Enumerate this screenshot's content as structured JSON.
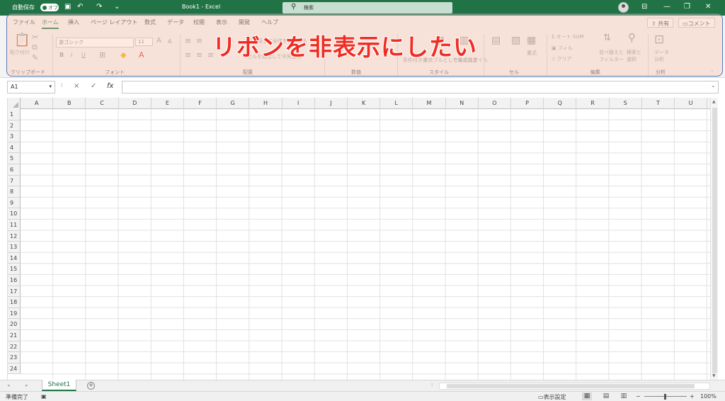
{
  "titlebar": {
    "autosave_label": "自動保存",
    "autosave_state": "オフ",
    "doc_title": "Book1  -  Excel",
    "search_placeholder": "検索",
    "icons": [
      "save-icon",
      "undo-icon",
      "redo-icon",
      "customize-icon",
      "account-icon",
      "ribbon-display-icon",
      "minimize-icon",
      "restore-icon",
      "close-icon"
    ]
  },
  "ribbon": {
    "tabs": [
      "ファイル",
      "ホーム",
      "挿入",
      "ページ レイアウト",
      "数式",
      "データ",
      "校閲",
      "表示",
      "開発",
      "ヘルプ"
    ],
    "active_tab": "ホーム",
    "share_label": "共有",
    "comment_label": "コメント",
    "clipboard": {
      "paste_label": "貼り付け",
      "group_label": "クリップボード"
    },
    "font": {
      "font_name": "游ゴシック",
      "font_size": "11",
      "grow": "A",
      "shrink": "A",
      "bold": "B",
      "italic": "I",
      "underline": "U",
      "group_label": "フォント"
    },
    "alignment": {
      "wrap_label": "折り返して全体を表示する",
      "merge_label": "セルを結合して中央揃え",
      "group_label": "配置"
    },
    "number": {
      "percent": "%",
      "group_label": "数値"
    },
    "styles": {
      "cond_format": "条件付き書式",
      "table_format": "テーブルとして書式設定",
      "cell_styles": "セルのスタイル",
      "group_label": "スタイル"
    },
    "cells": {
      "format_label": "書式",
      "group_label": "セル"
    },
    "editing": {
      "autosum": "オート SUM",
      "fill": "フィル",
      "clear": "クリア",
      "sort_filter": "並べ替えと フィルター",
      "find_select": "検索と 選択",
      "group_label": "編集"
    },
    "analysis": {
      "analyze_label": "データ 分析",
      "group_label": "分析"
    }
  },
  "overlay": {
    "headline": "リボンを非表示にしたい",
    "accent_color": "#ef2d22"
  },
  "formula_bar": {
    "name_box": "A1",
    "fx_label": "fx",
    "cancel_icon": "×",
    "enter_icon": "✓",
    "value": ""
  },
  "grid": {
    "columns": [
      "A",
      "B",
      "C",
      "D",
      "E",
      "F",
      "G",
      "H",
      "I",
      "J",
      "K",
      "L",
      "M",
      "N",
      "O",
      "P",
      "Q",
      "R",
      "S",
      "T",
      "U"
    ],
    "rows": [
      "1",
      "2",
      "3",
      "4",
      "5",
      "6",
      "7",
      "8",
      "9",
      "10",
      "11",
      "12",
      "13",
      "14",
      "15",
      "16",
      "17",
      "18",
      "19",
      "20",
      "21",
      "22",
      "23",
      "24"
    ]
  },
  "sheets": {
    "tabs": [
      "Sheet1"
    ],
    "active": "Sheet1",
    "add_label": "+"
  },
  "statusbar": {
    "ready": "準備完了",
    "display_settings": "表示設定",
    "zoom": "100%",
    "zoom_minus": "−",
    "zoom_plus": "+"
  },
  "theme": {
    "brand": "#217346",
    "overlay_border": "#5a78b8"
  }
}
